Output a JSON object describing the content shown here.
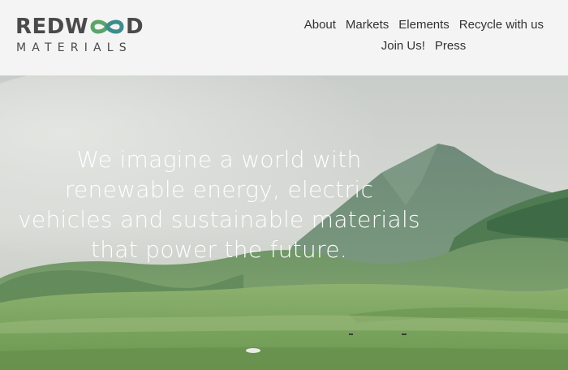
{
  "brand": {
    "name_part1": "REDW",
    "name_part2": "D",
    "subtitle": "MATERIALS",
    "colors": {
      "text": "#4a4a4a",
      "infinity_green": "#5aa56a",
      "infinity_teal": "#3d8c8a"
    }
  },
  "nav": {
    "row1": [
      "About",
      "Markets",
      "Elements",
      "Recycle with us"
    ],
    "row2": [
      "Join Us!",
      "Press"
    ]
  },
  "hero": {
    "headline": "We imagine a world with renewable energy, electric vehicles and sustainable materials that power the future."
  }
}
